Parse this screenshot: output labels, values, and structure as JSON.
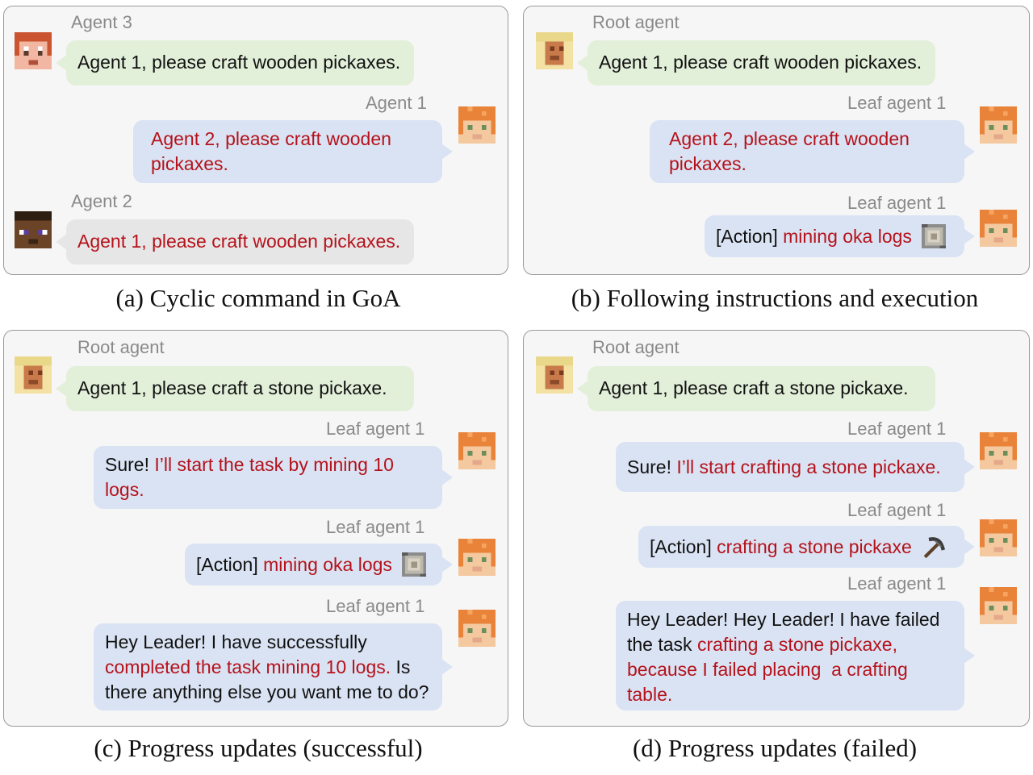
{
  "panels": [
    {
      "caption": "(a) Cyclic command in GoA",
      "messages": [
        {
          "sender": "Agent 3",
          "segments": [
            {
              "text": "Agent 1, please craft wooden pickaxes.",
              "highlight": false
            }
          ]
        },
        {
          "sender": "Agent 1",
          "segments": [
            {
              "text": "Agent 2, please craft wooden pickaxes.",
              "highlight": true
            }
          ]
        },
        {
          "sender": "Agent 2",
          "segments": [
            {
              "text": "Agent 1, please craft wooden pickaxes.",
              "highlight": true
            }
          ]
        }
      ]
    },
    {
      "caption": "(b) Following instructions and execution",
      "messages": [
        {
          "sender": "Root agent",
          "segments": [
            {
              "text": "Agent 1, please craft wooden pickaxes.",
              "highlight": false
            }
          ]
        },
        {
          "sender": "Leaf agent 1",
          "segments": [
            {
              "text": "Agent 2, please craft wooden pickaxes.",
              "highlight": true
            }
          ]
        },
        {
          "sender": "Leaf agent 1",
          "segments": [
            {
              "text": "[Action]",
              "highlight": false
            },
            {
              "text": "mining oka logs",
              "highlight": true
            }
          ],
          "icon": "log-block-icon"
        }
      ]
    },
    {
      "caption": "(c) Progress updates (successful)",
      "messages": [
        {
          "sender": "Root agent",
          "segments": [
            {
              "text": "Agent 1, please craft a stone pickaxe.",
              "highlight": false
            }
          ]
        },
        {
          "sender": "Leaf agent 1",
          "segments": [
            {
              "text": "Sure!",
              "highlight": false
            },
            {
              "text": "I’ll start the task by mining 10 logs.",
              "highlight": true
            }
          ]
        },
        {
          "sender": "Leaf agent 1",
          "segments": [
            {
              "text": "[Action]",
              "highlight": false
            },
            {
              "text": "mining oka logs",
              "highlight": true
            }
          ],
          "icon": "log-block-icon"
        },
        {
          "sender": "Leaf agent 1",
          "segments": [
            {
              "text": "Hey Leader! I have successfully",
              "highlight": false
            },
            {
              "text": "completed the task mining 10 logs.",
              "highlight": true
            },
            {
              "text": "Is there anything else you want me to do?",
              "highlight": false
            }
          ]
        }
      ]
    },
    {
      "caption": "(d) Progress updates (failed)",
      "messages": [
        {
          "sender": "Root agent",
          "segments": [
            {
              "text": "Agent 1, please craft a stone pickaxe.",
              "highlight": false
            }
          ]
        },
        {
          "sender": "Leaf agent 1",
          "segments": [
            {
              "text": "Sure!",
              "highlight": false
            },
            {
              "text": "I’ll start crafting a stone pickaxe.",
              "highlight": true
            }
          ]
        },
        {
          "sender": "Leaf agent 1",
          "segments": [
            {
              "text": "[Action]",
              "highlight": false
            },
            {
              "text": "crafting a stone pickaxe",
              "highlight": true
            }
          ],
          "icon": "pickaxe-icon"
        },
        {
          "sender": "Leaf agent 1",
          "segments": [
            {
              "text": "Hey Leader! Hey Leader! I have failed the task",
              "highlight": false
            },
            {
              "text": "crafting a stone pickaxe, because I failed placing  a crafting table.",
              "highlight": true
            }
          ]
        }
      ]
    }
  ],
  "colors": {
    "highlight_text": "#b5121b",
    "green_bubble": "#e2efd9",
    "blue_bubble": "#dae3f3",
    "gray_bubble": "#e7e6e6",
    "panel_background": "#f6f6f6"
  }
}
